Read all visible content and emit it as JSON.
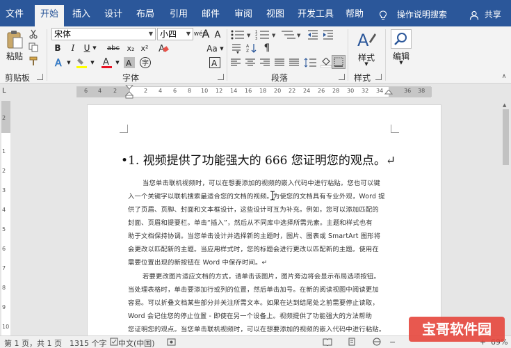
{
  "tabs": {
    "file": "文件",
    "home": "开始",
    "insert": "插入",
    "design": "设计",
    "layout": "布局",
    "references": "引用",
    "mailings": "邮件",
    "review": "审阅",
    "view": "视图",
    "developer": "开发工具",
    "help": "帮助"
  },
  "tell_me": "操作说明搜索",
  "share": "共享",
  "ribbon": {
    "clipboard": {
      "paste": "粘贴",
      "label": "剪贴板"
    },
    "font": {
      "name": "宋体",
      "size": "小四",
      "label": "字体",
      "bold": "B",
      "italic": "I",
      "underline": "U",
      "strike": "abc",
      "subscript": "x₂",
      "superscript": "x²",
      "grow": "A",
      "shrink": "A",
      "aa": "Aa",
      "wen": "wén",
      "a_border": "A",
      "a_color": "A",
      "a_shade": "A",
      "a_circle": "字"
    },
    "paragraph": {
      "label": "段落"
    },
    "styles": {
      "button": "样式",
      "label": "样式"
    },
    "editing": {
      "button": "编辑"
    }
  },
  "ruler": {
    "numbers": [
      "6",
      "4",
      "2",
      "2",
      "4",
      "6",
      "8",
      "10",
      "12",
      "14",
      "16",
      "18",
      "20",
      "22",
      "24",
      "26",
      "28",
      "30",
      "32",
      "34",
      "36",
      "38"
    ],
    "vertical": [
      "2",
      "1",
      "1",
      "2",
      "3",
      "4",
      "5",
      "6",
      "7",
      "8",
      "9",
      "10",
      "11"
    ],
    "tab_selector": "L"
  },
  "document": {
    "heading": "•1. 视频提供了功能强大的 666 您证明您的观点。↵",
    "lines": [
      "当您单击联机视频时，可以在想要添加的视频的嵌入代码中进行粘贴。您也可以键",
      "入一个关键字以联机搜索最适合您的文档的视频。为使您的文档具有专业外观，Word 提",
      "供了页眉、页脚、封面和文本框设计，这些设计可互为补充。例如，您可以添加匹配的",
      "封面、页眉和提要栏。单击“插入”，然后从不同库中选择所需元素。主题和样式也有",
      "助于文档保持协调。当您单击设计并选择新的主题时，图片、图表或 SmartArt 图形将",
      "会更改以匹配新的主题。当应用样式时，您的标题会进行更改以匹配新的主题。使用在",
      "需要位置出现的新按钮在 Word 中保存时间。↵",
      "若要更改图片适应文档的方式，请单击该图片，图片旁边将会显示布局选项按钮。",
      "当处理表格时，单击要添加行或列的位置，然后单击加号。在新的阅读视图中阅读更加",
      "容易。可以折叠文档某些部分并关注所需文本。如果在达到结尾处之前需要停止读取，",
      "Word 会记住您的停止位置 - 即使在另一个设备上。视频提供了功能强大的方法帮助",
      "您证明您的观点。当您单击联机视频时，可以在想要添加的视频的嵌入代码中进行粘贴。"
    ]
  },
  "status": {
    "page": "第 1 页，共 1 页",
    "words": "1315 个字",
    "lang": "中文(中国)",
    "zoom": "69%"
  },
  "watermark": "宝哥软件园",
  "colors": {
    "accent": "#2b579a",
    "ribbon_bg": "#f3f3f3",
    "highlight": "#ffff00",
    "font_color": "#e81123"
  }
}
